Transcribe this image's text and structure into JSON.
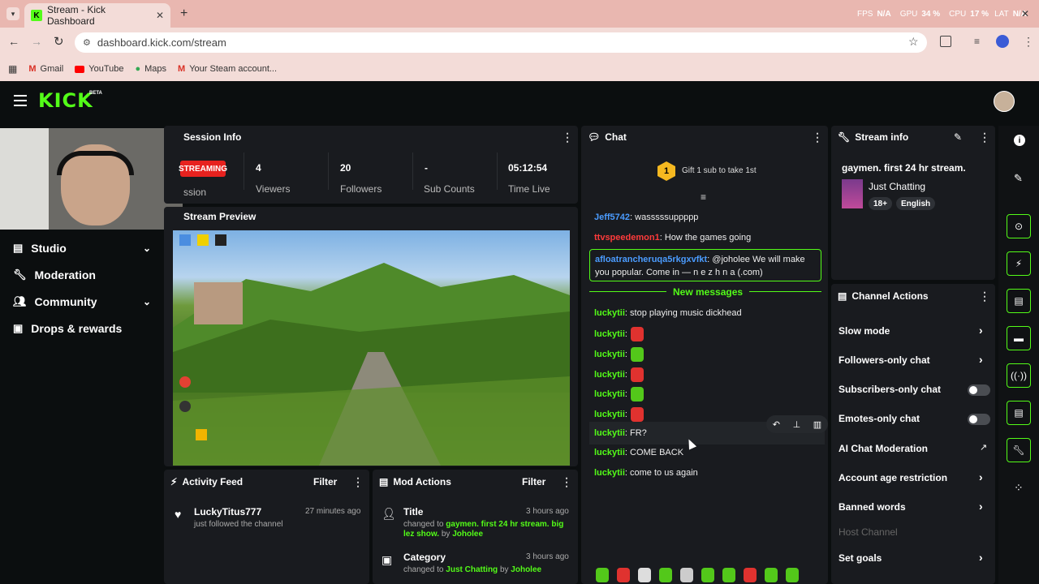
{
  "browser": {
    "tab_title": "Stream - Kick Dashboard",
    "url": "dashboard.kick.com/stream",
    "bookmarks": [
      "Gmail",
      "YouTube",
      "Maps",
      "Your Steam account..."
    ],
    "perf": {
      "fps_label": "FPS",
      "fps_val": "N/A",
      "gpu_label": "GPU",
      "gpu_val": "34 %",
      "cpu_label": "CPU",
      "cpu_val": "17 %",
      "lat_label": "LAT",
      "lat_val": "N/A"
    }
  },
  "brand": {
    "logo": "KICK",
    "beta": "BETA"
  },
  "sidebar": {
    "items": [
      {
        "label": "Studio"
      },
      {
        "label": "Moderation"
      },
      {
        "label": "Community"
      },
      {
        "label": "Drops & rewards"
      }
    ]
  },
  "session": {
    "title": "Session Info",
    "badge": "STREAMING",
    "session_label": "ssion",
    "stats": [
      {
        "value": "4",
        "label": "Viewers"
      },
      {
        "value": "20",
        "label": "Followers"
      },
      {
        "value": "-",
        "label": "Sub Counts"
      },
      {
        "value": "05:12:54",
        "label": "Time Live"
      }
    ]
  },
  "preview": {
    "title": "Stream Preview"
  },
  "activity": {
    "title": "Activity Feed",
    "filter": "Filter",
    "user": "LuckyTitus777",
    "time": "27 minutes ago",
    "text": "just followed the channel"
  },
  "mod": {
    "title": "Mod Actions",
    "filter": "Filter",
    "items": [
      {
        "title": "Title",
        "time": "3 hours ago",
        "pre": "changed to",
        "value": "gaymen. first 24 hr stream. big lez show.",
        "by": "by",
        "user": "Joholee"
      },
      {
        "title": "Category",
        "time": "3 hours ago",
        "pre": "changed to",
        "value": "Just Chatting",
        "by": "by",
        "user": "Joholee"
      }
    ]
  },
  "chat": {
    "title": "Chat",
    "gift_num": "1",
    "gift_text": "Gift 1 sub to take 1st",
    "messages": [
      {
        "user": "Jeff5742",
        "text": ": wasssssuppppp"
      },
      {
        "user": "ttvspeedemon1",
        "text": ": How the games going"
      },
      {
        "user": "afloatrancheruqa5rkgxvfkt",
        "text": ": @joholee We will make you popular. Come in — n e z h n a (.com)"
      }
    ],
    "new_messages": "New messages",
    "new": [
      {
        "user": "luckytii",
        "text": ": stop playing music dickhead"
      },
      {
        "user": "luckytii",
        "text": ":",
        "emote": "red"
      },
      {
        "user": "luckytii",
        "text": ":",
        "emote": "green"
      },
      {
        "user": "luckytii",
        "text": ":",
        "emote": "red"
      },
      {
        "user": "luckytii",
        "text": ":",
        "emote": "green"
      },
      {
        "user": "luckytii",
        "text": ":",
        "emote": "red"
      },
      {
        "user": "luckytii",
        "text": ": FR?"
      },
      {
        "user": "luckytii",
        "text": ": COME BACK"
      },
      {
        "user": "luckytii",
        "text": ": come to us again"
      }
    ]
  },
  "stream_info": {
    "title": "Stream info",
    "stream_title": "gaymen. first 24 hr stream.",
    "category": "Just Chatting",
    "tags": [
      "18+",
      "English"
    ]
  },
  "channel_actions": {
    "title": "Channel Actions",
    "items": [
      {
        "label": "Slow mode",
        "control": "arrow"
      },
      {
        "label": "Followers-only chat",
        "control": "arrow"
      },
      {
        "label": "Subscribers-only chat",
        "control": "toggle"
      },
      {
        "label": "Emotes-only chat",
        "control": "toggle"
      },
      {
        "label": "AI Chat Moderation",
        "control": "external"
      },
      {
        "label": "Account age restriction",
        "control": "arrow"
      },
      {
        "label": "Banned words",
        "control": "arrow"
      },
      {
        "label": "Host Channel",
        "control": "none",
        "disabled": true
      },
      {
        "label": "Set goals",
        "control": "arrow"
      }
    ]
  },
  "colors": {
    "accent": "#53fc18",
    "panel": "#191b1f",
    "bg": "#0b0e0f"
  }
}
